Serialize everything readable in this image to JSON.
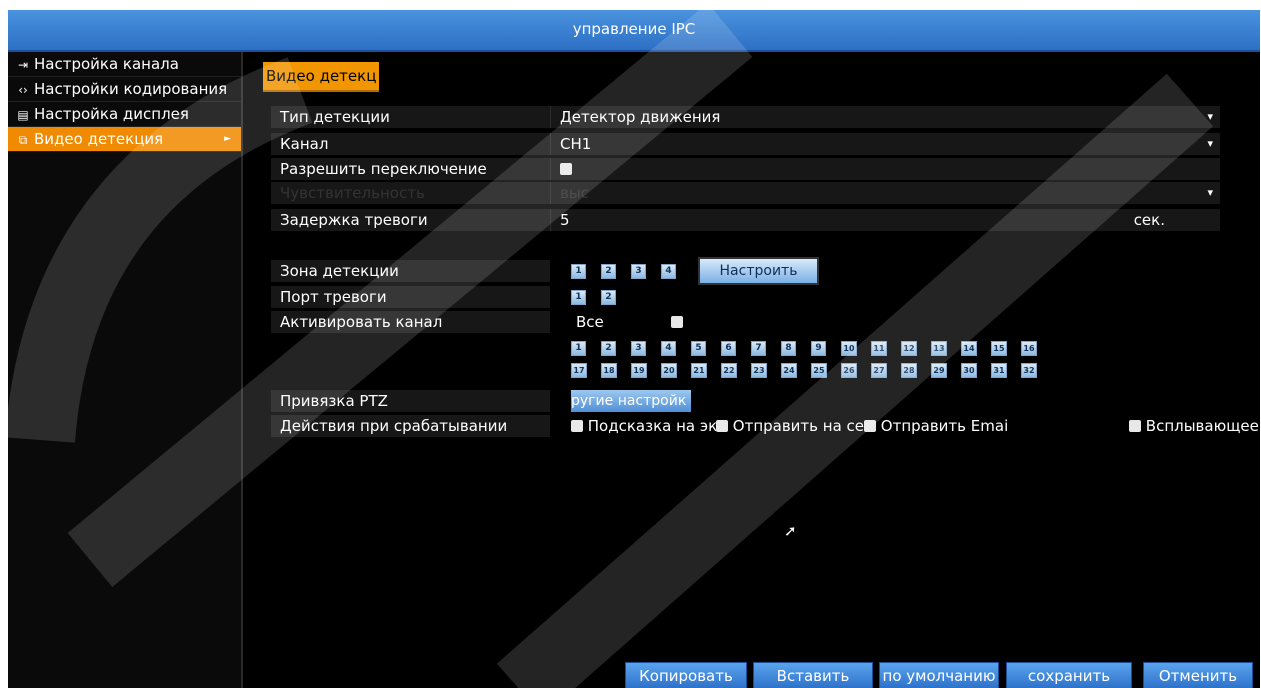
{
  "window": {
    "title": "управление IPC"
  },
  "sidebar": {
    "items": [
      {
        "icon": "input-icon",
        "glyph": "⇥",
        "label": "Настройка канала"
      },
      {
        "icon": "code-icon",
        "glyph": "‹›",
        "label": "Настройки кодирования"
      },
      {
        "icon": "display-icon",
        "glyph": "▤",
        "label": "Настройка дисплея"
      },
      {
        "icon": "camera-icon",
        "glyph": "⧉",
        "label": "Видео детекция",
        "active": true
      }
    ]
  },
  "tab": {
    "label": "Видео детекц"
  },
  "form": {
    "detection_type": {
      "label": "Тип детекции",
      "value": "Детектор движения"
    },
    "channel": {
      "label": "Канал",
      "value": "CH1"
    },
    "allow_switch": {
      "label": "Разрешить переключение"
    },
    "sensitivity": {
      "label": "Чувствительность",
      "value": "выс"
    },
    "alarm_delay": {
      "label": "Задержка тревоги",
      "value": "5",
      "unit": "сек."
    }
  },
  "zone": {
    "label": "Зона детекции",
    "numbers": [
      "1",
      "2",
      "3",
      "4"
    ],
    "configure_label": "Настроить"
  },
  "alarm_port": {
    "label": "Порт тревоги",
    "numbers": [
      "1",
      "2"
    ]
  },
  "activate_channel": {
    "label": "Активировать канал",
    "all_label": "Все",
    "row1": [
      "1",
      "2",
      "3",
      "4",
      "5",
      "6",
      "7",
      "8",
      "9",
      "10",
      "11",
      "12",
      "13",
      "14",
      "15",
      "16"
    ],
    "row2": [
      "17",
      "18",
      "19",
      "20",
      "21",
      "22",
      "23",
      "24",
      "25",
      "26",
      "27",
      "28",
      "29",
      "30",
      "31",
      "32"
    ]
  },
  "ptz": {
    "label": "Привязка PTZ",
    "button_label": "ругие  настройк"
  },
  "actions": {
    "label": "Действия при срабатывании",
    "options": [
      "Подсказка на эк",
      "Отправить на се",
      "Отправить Emai",
      "Всплывающее"
    ]
  },
  "buttons": {
    "copy": "Копировать",
    "paste": "Вставить",
    "default": "по умолчанию",
    "save": "сохранить",
    "cancel": "Отменить"
  },
  "colors": {
    "accent": "#f29600",
    "title": "#3a80d2",
    "background": "#000000"
  }
}
